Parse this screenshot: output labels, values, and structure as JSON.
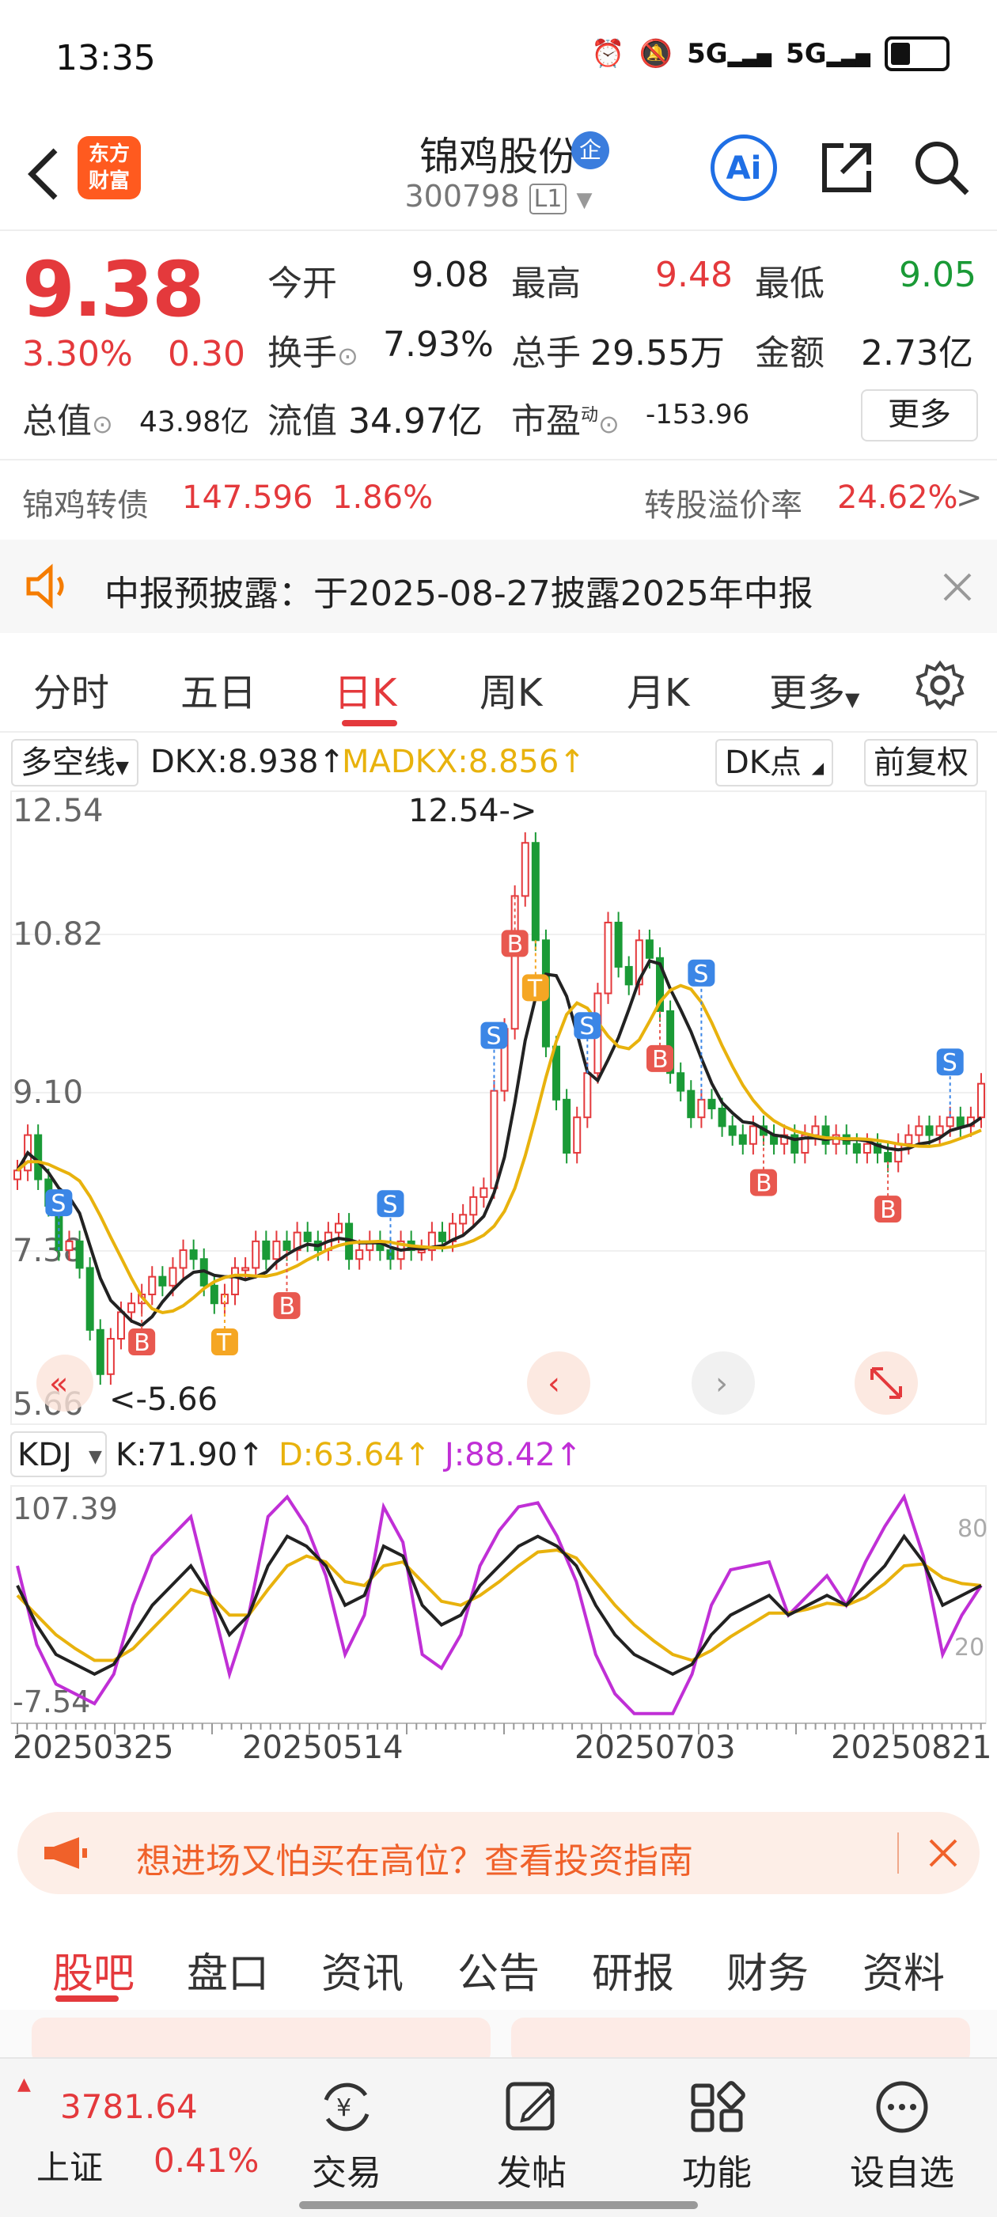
{
  "status_bar": {
    "time": "13:35",
    "icons": [
      "alarm-icon",
      "mute-icon",
      "signal-5g-icon",
      "signal-5g-icon",
      "battery-icon"
    ],
    "signal_label": "5G"
  },
  "header": {
    "logo_line1": "东方",
    "logo_line2": "财富",
    "stock_name": "锦鸡股份",
    "badge": "企",
    "stock_code": "300798",
    "level": "L1",
    "ai_label": "Ai"
  },
  "quote": {
    "price": "9.38",
    "change_pct": "3.30%",
    "change": "0.30",
    "open_label": "今开",
    "open": "9.08",
    "high_label": "最高",
    "high": "9.48",
    "low_label": "最低",
    "low": "9.05",
    "turnover_label": "换手",
    "turnover": "7.93%",
    "volume_label": "总手",
    "volume": "29.55万",
    "amount_label": "金额",
    "amount": "2.73亿",
    "total_cap_label": "总值",
    "total_cap": "43.98亿",
    "float_cap_label": "流值",
    "float_cap": "34.97亿",
    "pe_label": "市盈",
    "pe_sup": "动",
    "pe": "-153.96",
    "more_label": "更多",
    "bond_label": "锦鸡转债",
    "bond_price": "147.596",
    "bond_pct": "1.86%",
    "premium_label": "转股溢价率",
    "premium": "24.62%",
    "premium_arrow": ">"
  },
  "notice": {
    "text": "中报预披露：于2025-08-27披露2025年中报"
  },
  "kline_tabs": [
    {
      "label": "分时",
      "active": false
    },
    {
      "label": "五日",
      "active": false
    },
    {
      "label": "日K",
      "active": true
    },
    {
      "label": "周K",
      "active": false
    },
    {
      "label": "月K",
      "active": false
    },
    {
      "label": "更多",
      "active": false
    }
  ],
  "indicator": {
    "main_select": "多空线",
    "dkx": "DKX:8.938",
    "madkx": "MADKX:8.856",
    "dk_points": "DK点",
    "adjust": "前复权",
    "kdj_select": "KDJ",
    "k": "K:71.90",
    "d": "D:63.64",
    "j": "J:88.42",
    "arrow": "↑"
  },
  "chart_data": {
    "type": "candlestick",
    "y_max_label": "12.54",
    "y_labels": [
      "12.54",
      "10.82",
      "9.10",
      "7.38",
      "5.66"
    ],
    "ylim": [
      5.66,
      12.54
    ],
    "peak_annotation": "12.54->",
    "low_annotation": "<-5.66",
    "series": [
      {
        "name": "DKX",
        "color": "#222222"
      },
      {
        "name": "MADKX",
        "color": "#e8b20d"
      }
    ],
    "closes": [
      8.4,
      8.8,
      8.3,
      8.0,
      7.5,
      7.6,
      7.3,
      6.6,
      6.1,
      6.5,
      6.8,
      6.9,
      7.0,
      7.2,
      7.1,
      7.3,
      7.5,
      7.4,
      7.1,
      6.9,
      7.0,
      7.3,
      7.3,
      7.6,
      7.4,
      7.6,
      7.5,
      7.7,
      7.6,
      7.5,
      7.7,
      7.8,
      7.4,
      7.5,
      7.6,
      7.5,
      7.4,
      7.6,
      7.5,
      7.5,
      7.7,
      7.6,
      7.8,
      7.9,
      8.1,
      8.2,
      9.3,
      10.0,
      11.5,
      12.1,
      11.0,
      9.8,
      9.2,
      8.6,
      9.0,
      9.5,
      10.4,
      11.2,
      10.7,
      10.5,
      11.0,
      10.8,
      10.2,
      9.5,
      9.3,
      9.0,
      9.2,
      9.1,
      8.9,
      8.8,
      8.7,
      8.9,
      8.8,
      8.7,
      8.8,
      8.6,
      8.8,
      8.9,
      8.7,
      8.8,
      8.7,
      8.6,
      8.7,
      8.6,
      8.5,
      8.7,
      8.8,
      8.9,
      8.8,
      8.9,
      9.0,
      8.9,
      9.0,
      9.38
    ],
    "kdj": {
      "ylim": [
        -7.54,
        107.39
      ],
      "y_labels": [
        "107.39",
        "-7.54"
      ],
      "right_labels": [
        "80",
        "20"
      ],
      "K": [
        60,
        40,
        25,
        20,
        15,
        20,
        35,
        50,
        60,
        70,
        55,
        35,
        45,
        70,
        85,
        80,
        70,
        50,
        55,
        80,
        75,
        50,
        40,
        45,
        60,
        70,
        80,
        85,
        80,
        70,
        50,
        35,
        25,
        20,
        15,
        20,
        35,
        45,
        50,
        55,
        45,
        50,
        55,
        50,
        60,
        70,
        85,
        72,
        50,
        55,
        60
      ],
      "D": [
        55,
        45,
        35,
        28,
        22,
        22,
        28,
        38,
        48,
        58,
        55,
        45,
        45,
        58,
        70,
        75,
        72,
        62,
        60,
        70,
        72,
        62,
        52,
        50,
        55,
        62,
        70,
        77,
        78,
        74,
        62,
        50,
        40,
        32,
        25,
        22,
        27,
        34,
        40,
        46,
        46,
        48,
        51,
        50,
        54,
        61,
        70,
        71,
        64,
        61,
        60
      ],
      "J": [
        70,
        30,
        10,
        5,
        0,
        15,
        50,
        75,
        85,
        95,
        55,
        15,
        45,
        95,
        105,
        90,
        65,
        25,
        45,
        100,
        82,
        25,
        18,
        35,
        70,
        88,
        100,
        102,
        85,
        62,
        25,
        5,
        -5,
        -5,
        -5,
        15,
        50,
        68,
        70,
        72,
        45,
        55,
        65,
        50,
        72,
        90,
        105,
        75,
        25,
        45,
        60
      ]
    },
    "x_labels": [
      "20250325",
      "20250514",
      "20250703",
      "20250821"
    ]
  },
  "banner": {
    "text": "想进场又怕买在高位？查看投资指南"
  },
  "bottom_tabs": [
    {
      "label": "股吧",
      "active": true
    },
    {
      "label": "盘口",
      "active": false
    },
    {
      "label": "资讯",
      "active": false
    },
    {
      "label": "公告",
      "active": false
    },
    {
      "label": "研报",
      "active": false
    },
    {
      "label": "财务",
      "active": false
    },
    {
      "label": "资料",
      "active": false
    }
  ],
  "bottom_nav": {
    "index_value": "3781.64",
    "index_name": "上证",
    "index_pct": "0.41%",
    "items": [
      {
        "label": "交易",
        "icon": "yuan-exchange-icon"
      },
      {
        "label": "发帖",
        "icon": "edit-icon"
      },
      {
        "label": "功能",
        "icon": "grid-icon"
      },
      {
        "label": "设自选",
        "icon": "more-dots-icon"
      }
    ]
  },
  "colors": {
    "up": "#e4393c",
    "down": "#1a9a36",
    "accent": "#f57c00",
    "blue": "#1f6fe5"
  }
}
